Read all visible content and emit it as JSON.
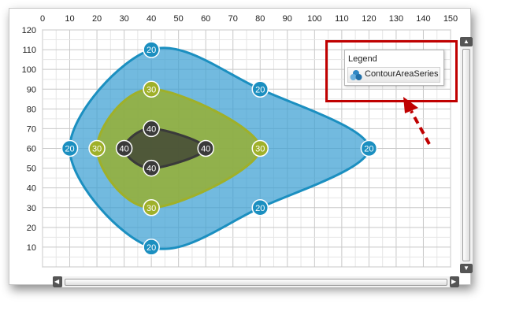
{
  "chart_data": {
    "type": "contour-area",
    "x_ticks": [
      "0",
      "10",
      "20",
      "30",
      "40",
      "50",
      "60",
      "70",
      "80",
      "90",
      "100",
      "110",
      "120",
      "130",
      "140",
      "150"
    ],
    "y_ticks": [
      "120",
      "110",
      "100",
      "90",
      "80",
      "70",
      "60",
      "50",
      "40",
      "30",
      "20",
      "10"
    ],
    "xlim": [
      0,
      150
    ],
    "ylim": [
      0,
      120
    ],
    "grid": true,
    "x_axis_position": "top",
    "contours": [
      {
        "level": "20",
        "color": "#1b8fc0",
        "points": [
          [
            10,
            60
          ],
          [
            40,
            110
          ],
          [
            80,
            90
          ],
          [
            120,
            60
          ],
          [
            80,
            30
          ],
          [
            40,
            10
          ]
        ]
      },
      {
        "level": "30",
        "color": "#9fb029",
        "points": [
          [
            20,
            60
          ],
          [
            40,
            90
          ],
          [
            80,
            60
          ],
          [
            40,
            30
          ]
        ]
      },
      {
        "level": "40",
        "color": "#3a3a3a",
        "points": [
          [
            30,
            60
          ],
          [
            40,
            70
          ],
          [
            60,
            60
          ],
          [
            40,
            50
          ]
        ]
      }
    ],
    "legend_position": "top-right"
  },
  "legend": {
    "title": "Legend",
    "series_name": "ContourAreaSeries"
  }
}
